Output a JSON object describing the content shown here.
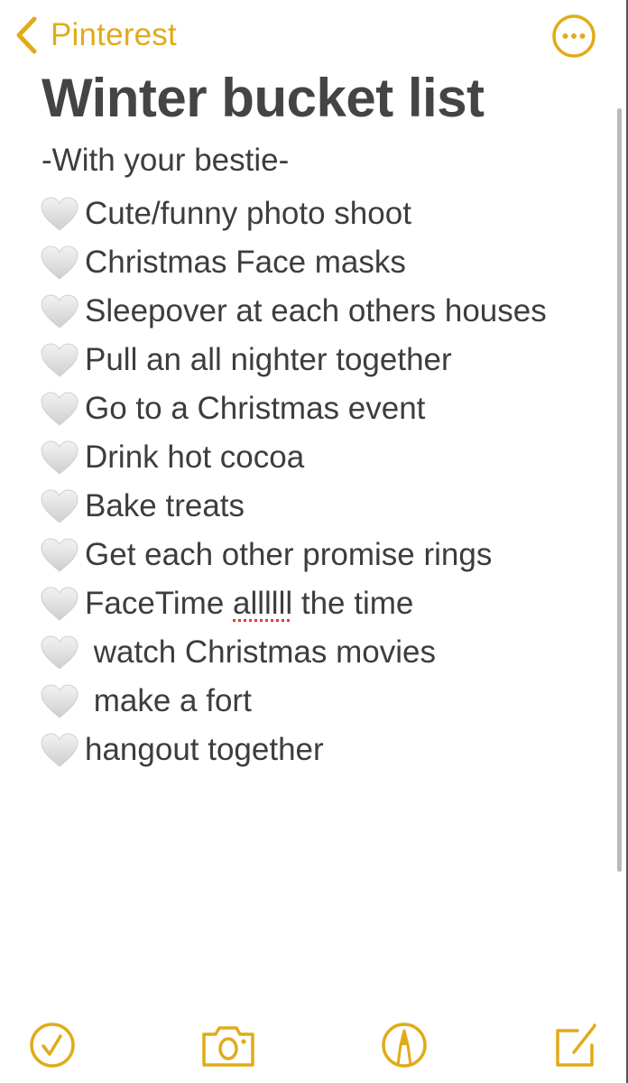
{
  "nav": {
    "back_label": "Pinterest",
    "back_icon": "chevron-left-icon",
    "more_icon": "ellipsis-circle-icon"
  },
  "note": {
    "title": "Winter bucket list",
    "subtitle": "-With your bestie-",
    "bullet_icon": "white-heart-icon",
    "items": [
      {
        "text": "Cute/funny photo shoot"
      },
      {
        "text": "Christmas Face masks"
      },
      {
        "text": "Sleepover at each others houses"
      },
      {
        "text": "Pull an all nighter together"
      },
      {
        "text": "Go to a Christmas event"
      },
      {
        "text": "Drink hot cocoa"
      },
      {
        "text": "Bake treats"
      },
      {
        "text": "Get each other promise rings"
      },
      {
        "pre": "FaceTime ",
        "misspelled": "allllll",
        "post": " the time"
      },
      {
        "text": " watch Christmas movies"
      },
      {
        "text": " make a fort"
      },
      {
        "text": "hangout together"
      }
    ]
  },
  "toolbar": {
    "checklist_icon": "checklist-icon",
    "camera_icon": "camera-icon",
    "markup_icon": "markup-pen-icon",
    "compose_icon": "compose-icon"
  },
  "colors": {
    "accent": "#e1ab19",
    "text": "#3d3d3d",
    "title": "#444444",
    "heart": "#d9d9d9",
    "spellcheck": "#e53935"
  }
}
